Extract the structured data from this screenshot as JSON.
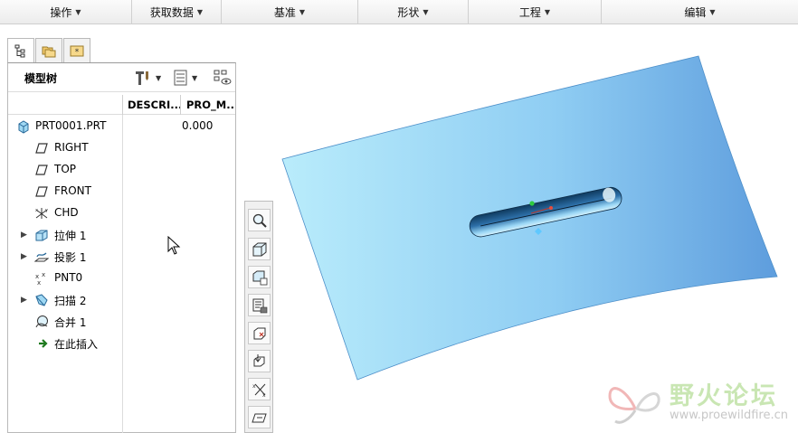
{
  "ribbon": {
    "groups": [
      {
        "label": "操作"
      },
      {
        "label": "获取数据"
      },
      {
        "label": "基准"
      },
      {
        "label": "形状"
      },
      {
        "label": "工程"
      },
      {
        "label": "编辑"
      }
    ]
  },
  "panel_tabs": [
    {
      "icon": "model-tree-icon",
      "active": true
    },
    {
      "icon": "folder-browser-icon",
      "active": false
    },
    {
      "icon": "favorites-icon",
      "active": false
    }
  ],
  "model_tree": {
    "title": "模型树",
    "columns": {
      "description": "DESCRI...",
      "pro_m": "PRO_M..."
    },
    "items": [
      {
        "label": "PRT0001.PRT",
        "icon": "part-icon",
        "value": "0.000",
        "expandable": false
      },
      {
        "label": "RIGHT",
        "icon": "datum-plane-icon",
        "value": "",
        "expandable": false
      },
      {
        "label": "TOP",
        "icon": "datum-plane-icon",
        "value": "",
        "expandable": false
      },
      {
        "label": "FRONT",
        "icon": "datum-plane-icon",
        "value": "",
        "expandable": false
      },
      {
        "label": "CHD",
        "icon": "csys-icon",
        "value": "",
        "expandable": false
      },
      {
        "label": "拉伸 1",
        "icon": "extrude-icon",
        "value": "",
        "expandable": true
      },
      {
        "label": "投影 1",
        "icon": "projected-curve-icon",
        "value": "",
        "expandable": true
      },
      {
        "label": "PNT0",
        "icon": "datum-point-icon",
        "value": "",
        "expandable": false
      },
      {
        "label": "扫描 2",
        "icon": "sweep-icon",
        "value": "",
        "expandable": true
      },
      {
        "label": "合并 1",
        "icon": "merge-icon",
        "value": "",
        "expandable": false
      },
      {
        "label": "在此插入",
        "icon": "insert-here-arrow-icon",
        "value": "",
        "expandable": false
      }
    ]
  },
  "view_toolbar": [
    {
      "icon": "zoom-icon"
    },
    {
      "icon": "display-style-icon"
    },
    {
      "icon": "saved-views-icon"
    },
    {
      "icon": "view-manager-icon"
    },
    {
      "icon": "datum-plane-display-icon"
    },
    {
      "icon": "datum-axis-display-icon"
    },
    {
      "icon": "point-display-icon"
    },
    {
      "icon": "csys-display-icon"
    }
  ],
  "watermark": {
    "name": "野火论坛",
    "url": "www.proewildfire.cn"
  },
  "colors": {
    "surface_light": "#b9ecfb",
    "surface_dark": "#5e9ddd",
    "watermark_green": "#c9e6b3"
  }
}
